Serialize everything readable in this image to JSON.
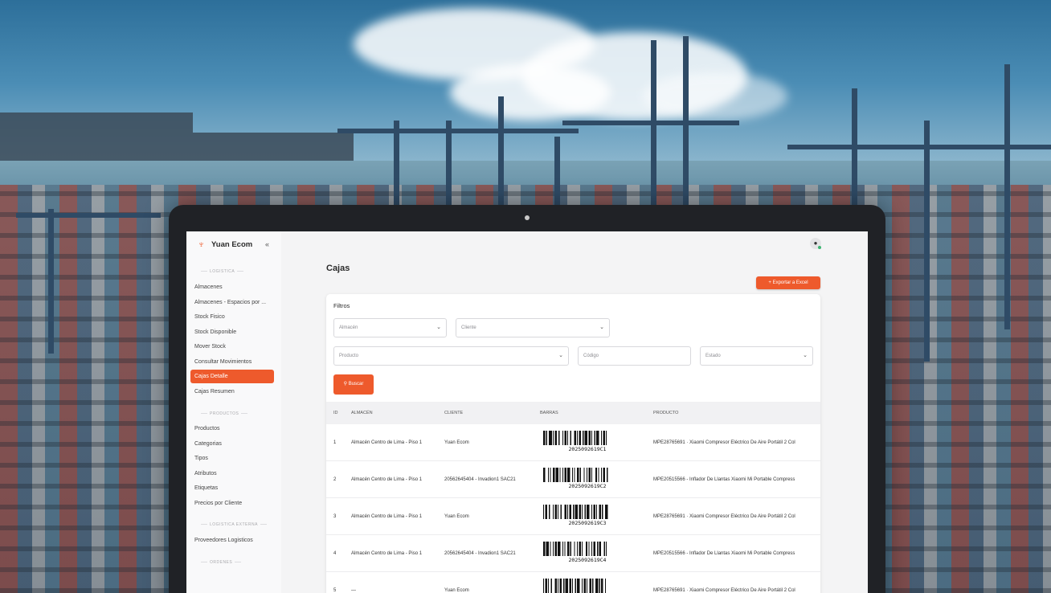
{
  "sidebar": {
    "brand": "Yuan Ecom",
    "collapse_icon": "«",
    "sections": [
      {
        "label": "LOGISTICA",
        "items": [
          "Almacenes",
          "Almacenes - Espacios por ...",
          "Stock Fisico",
          "Stock Disponible",
          "Mover Stock",
          "Consultar Movimientos",
          "Cajas Detalle",
          "Cajas Resumen"
        ]
      },
      {
        "label": "PRODUCTOS",
        "items": [
          "Productos",
          "Categorias",
          "Tipos",
          "Atributos",
          "Etiquetas",
          "Precios por Cliente"
        ]
      },
      {
        "label": "LOGISTICA EXTERNA",
        "items": [
          "Proveedores Logisticos"
        ]
      },
      {
        "label": "ORDENES",
        "items": []
      }
    ],
    "active_item": "Cajas Detalle"
  },
  "header": {
    "user_icon": "user-icon"
  },
  "page": {
    "title": "Cajas",
    "export_label": "Exportar a Excel",
    "filters_title": "Filtros",
    "filters": {
      "almacen": "Almacén",
      "cliente": "Cliente",
      "producto": "Producto",
      "codigo": "Código",
      "estado": "Estado"
    },
    "search_label": "Buscar"
  },
  "table": {
    "columns": [
      "ID",
      "ALMACÉN",
      "CLIENTE",
      "BARRAS",
      "PRODUCTO"
    ],
    "rows": [
      {
        "id": "1",
        "almacen": "Almacén Centro de Lima - Piso 1",
        "cliente": "Yuan Ecom",
        "barras": "2025092619C1",
        "producto": "MPE28765691 · Xiaomi Compresor Eléctrico De Aire Portátil 2 Col"
      },
      {
        "id": "2",
        "almacen": "Almacén Centro de Lima - Piso 1",
        "cliente": "20562645404 - Invadion1 SAC21",
        "barras": "2025092619C2",
        "producto": "MPE20515566 - Inflador De Llantas Xiaomi Mi Portable Compress"
      },
      {
        "id": "3",
        "almacen": "Almacén Centro de Lima - Piso 1",
        "cliente": "Yuan Ecom",
        "barras": "2025092619C3",
        "producto": "MPE28765691 · Xiaomi Compresor Eléctrico De Aire Portátil 2 Col"
      },
      {
        "id": "4",
        "almacen": "Almacén Centro de Lima - Piso 1",
        "cliente": "20562645404 - Invadion1 SAC21",
        "barras": "2025092619C4",
        "producto": "MPE20515566 - Inflador De Llantas Xiaomi Mi Portable Compress"
      },
      {
        "id": "5",
        "almacen": "—",
        "cliente": "Yuan Ecom",
        "barras": "",
        "producto": "MPE28765691 · Xiaomi Compresor Eléctrico De Aire Portátil 2 Col"
      }
    ]
  },
  "colors": {
    "accent": "#ee5a2c"
  }
}
